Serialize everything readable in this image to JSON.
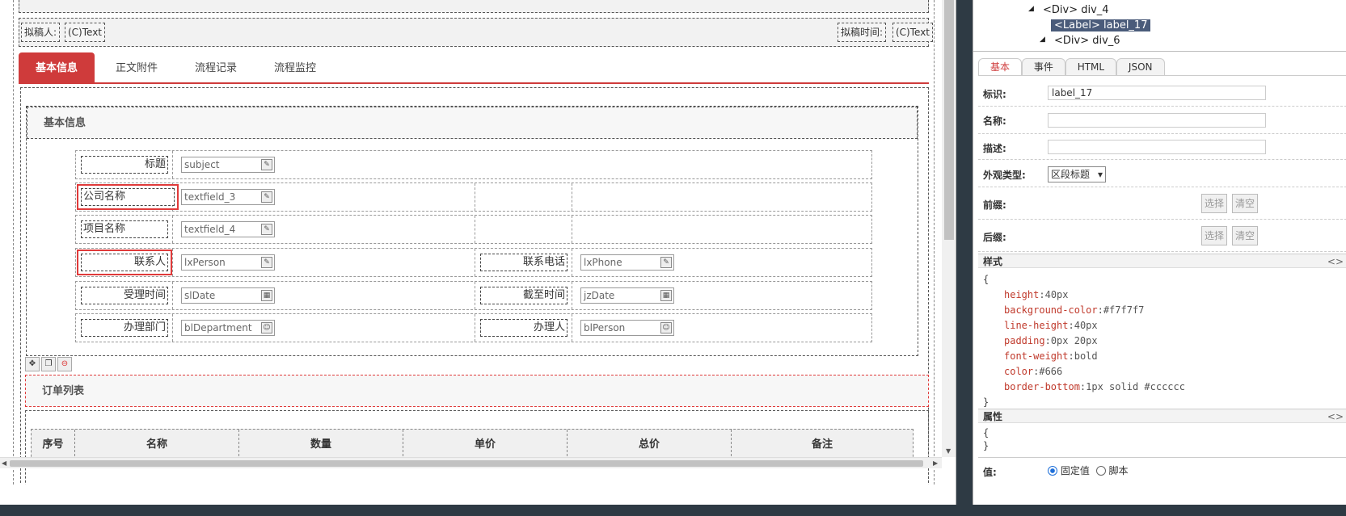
{
  "header": {
    "drafter_label": "拟稿人:",
    "drafter_value": "(C)Text",
    "draft_time_label": "拟稿时间:",
    "draft_time_value": "(C)Text"
  },
  "tabs": [
    {
      "label": "基本信息",
      "active": true
    },
    {
      "label": "正文附件",
      "active": false
    },
    {
      "label": "流程记录",
      "active": false
    },
    {
      "label": "流程监控",
      "active": false
    }
  ],
  "section1": {
    "title": "基本信息",
    "rows": [
      {
        "label": "标题",
        "field": "subject",
        "icon": "edit-icon"
      },
      {
        "label": "公司名称",
        "field": "textfield_3",
        "icon": "edit-icon"
      },
      {
        "label": "项目名称",
        "field": "textfield_4",
        "icon": "edit-icon"
      },
      {
        "label": "联系人",
        "field": "lxPerson",
        "icon": "edit-icon",
        "label2": "联系电话",
        "field2": "lxPhone",
        "icon2": "edit-icon"
      },
      {
        "label": "受理时间",
        "field": "slDate",
        "icon": "calendar-icon",
        "label2": "截至时间",
        "field2": "jzDate",
        "icon2": "calendar-icon"
      },
      {
        "label": "办理部门",
        "field": "blDepartment",
        "icon": "user-icon",
        "label2": "办理人",
        "field2": "blPerson",
        "icon2": "user-icon"
      }
    ]
  },
  "section2": {
    "title": "订单列表",
    "columns": [
      "序号",
      "名称",
      "数量",
      "单价",
      "总价",
      "备注"
    ]
  },
  "tree": {
    "node_div4": "<Div> div_4",
    "node_label17": "<Label> label_17",
    "node_div6": "<Div> div_6"
  },
  "inspector": {
    "tabs": [
      "基本",
      "事件",
      "HTML",
      "JSON"
    ],
    "id_label": "标识:",
    "id_value": "label_17",
    "name_label": "名称:",
    "desc_label": "描述:",
    "appearance_label": "外观类型:",
    "appearance_value": "区段标题",
    "prefix_label": "前缀:",
    "suffix_label": "后缀:",
    "select_btn": "选择",
    "clear_btn": "清空",
    "style_header": "样式",
    "toggle": "<>",
    "style_open": "{",
    "style_close": "}",
    "style_props": [
      {
        "k": "height",
        "v": "40px"
      },
      {
        "k": "background-color",
        "v": "#f7f7f7"
      },
      {
        "k": "line-height",
        "v": "40px"
      },
      {
        "k": "padding",
        "v": "0px 20px"
      },
      {
        "k": "font-weight",
        "v": "bold"
      },
      {
        "k": "color",
        "v": "#666"
      },
      {
        "k": "border-bottom",
        "v": "1px solid #cccccc"
      }
    ],
    "attr_header": "属性",
    "attr_open": "{",
    "attr_close": "}",
    "value_label": "值:",
    "radio_fixed": "固定值",
    "radio_script": "脚本"
  },
  "colors": {
    "accent": "#cf3b3b",
    "selected_node": "#4a5b7a"
  }
}
